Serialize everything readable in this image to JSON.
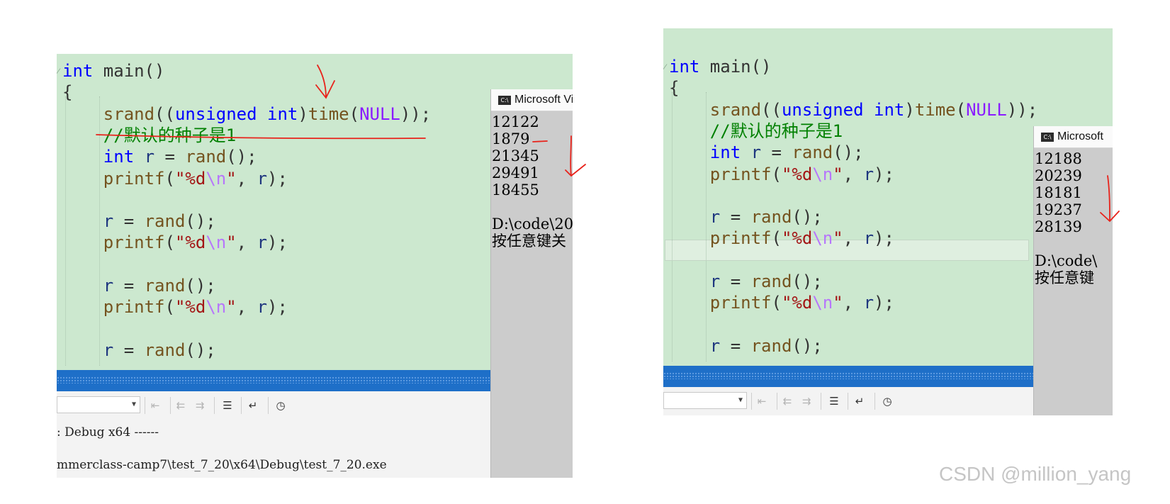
{
  "screenshots": [
    {
      "id": "left",
      "code_lines": [
        {
          "tokens": [
            {
              "t": "int",
              "c": "kw"
            },
            {
              "t": " main()",
              "c": "plain"
            }
          ]
        },
        {
          "tokens": [
            {
              "t": "{",
              "c": "plain"
            }
          ]
        },
        {
          "tokens": [
            {
              "t": "    ",
              "c": "plain"
            },
            {
              "t": "srand",
              "c": "fn"
            },
            {
              "t": "((",
              "c": "plain"
            },
            {
              "t": "unsigned",
              "c": "kw"
            },
            {
              "t": " ",
              "c": "plain"
            },
            {
              "t": "int",
              "c": "kw"
            },
            {
              "t": ")",
              "c": "plain"
            },
            {
              "t": "time",
              "c": "fn"
            },
            {
              "t": "(",
              "c": "plain"
            },
            {
              "t": "NULL",
              "c": "mac"
            },
            {
              "t": "));",
              "c": "plain"
            }
          ]
        },
        {
          "tokens": [
            {
              "t": "    ",
              "c": "plain"
            },
            {
              "t": "//默认的种子是1",
              "c": "cmt"
            }
          ]
        },
        {
          "tokens": [
            {
              "t": "    ",
              "c": "plain"
            },
            {
              "t": "int",
              "c": "kw"
            },
            {
              "t": " ",
              "c": "plain"
            },
            {
              "t": "r",
              "c": "var"
            },
            {
              "t": " = ",
              "c": "plain"
            },
            {
              "t": "rand",
              "c": "fn"
            },
            {
              "t": "();",
              "c": "plain"
            }
          ]
        },
        {
          "tokens": [
            {
              "t": "    ",
              "c": "plain"
            },
            {
              "t": "printf",
              "c": "fn"
            },
            {
              "t": "(",
              "c": "plain"
            },
            {
              "t": "\"%d",
              "c": "str"
            },
            {
              "t": "\\n",
              "c": "esc"
            },
            {
              "t": "\"",
              "c": "str"
            },
            {
              "t": ", ",
              "c": "plain"
            },
            {
              "t": "r",
              "c": "var"
            },
            {
              "t": ");",
              "c": "plain"
            }
          ]
        },
        {
          "tokens": []
        },
        {
          "tokens": [
            {
              "t": "    ",
              "c": "plain"
            },
            {
              "t": "r",
              "c": "var"
            },
            {
              "t": " = ",
              "c": "plain"
            },
            {
              "t": "rand",
              "c": "fn"
            },
            {
              "t": "();",
              "c": "plain"
            }
          ]
        },
        {
          "tokens": [
            {
              "t": "    ",
              "c": "plain"
            },
            {
              "t": "printf",
              "c": "fn"
            },
            {
              "t": "(",
              "c": "plain"
            },
            {
              "t": "\"%d",
              "c": "str"
            },
            {
              "t": "\\n",
              "c": "esc"
            },
            {
              "t": "\"",
              "c": "str"
            },
            {
              "t": ", ",
              "c": "plain"
            },
            {
              "t": "r",
              "c": "var"
            },
            {
              "t": ");",
              "c": "plain"
            }
          ]
        },
        {
          "tokens": []
        },
        {
          "tokens": [
            {
              "t": "    ",
              "c": "plain"
            },
            {
              "t": "r",
              "c": "var"
            },
            {
              "t": " = ",
              "c": "plain"
            },
            {
              "t": "rand",
              "c": "fn"
            },
            {
              "t": "();",
              "c": "plain"
            }
          ]
        },
        {
          "tokens": [
            {
              "t": "    ",
              "c": "plain"
            },
            {
              "t": "printf",
              "c": "fn"
            },
            {
              "t": "(",
              "c": "plain"
            },
            {
              "t": "\"%d",
              "c": "str"
            },
            {
              "t": "\\n",
              "c": "esc"
            },
            {
              "t": "\"",
              "c": "str"
            },
            {
              "t": ", ",
              "c": "plain"
            },
            {
              "t": "r",
              "c": "var"
            },
            {
              "t": ");",
              "c": "plain"
            }
          ]
        },
        {
          "tokens": []
        },
        {
          "tokens": [
            {
              "t": "    ",
              "c": "plain"
            },
            {
              "t": "r",
              "c": "var"
            },
            {
              "t": " = ",
              "c": "plain"
            },
            {
              "t": "rand",
              "c": "fn"
            },
            {
              "t": "();",
              "c": "plain"
            }
          ]
        }
      ],
      "console": {
        "title": "Microsoft Vi",
        "lines": [
          "12122",
          "1879",
          "21345",
          "29491",
          "18455",
          "",
          "D:\\code\\20",
          "按任意键关"
        ]
      },
      "output_lines": [
        ": Debug x64 ------",
        "mmerclass-camp7\\test_7_20\\x64\\Debug\\test_7_20.exe"
      ]
    },
    {
      "id": "right",
      "code_lines": [
        {
          "tokens": [
            {
              "t": "int",
              "c": "kw"
            },
            {
              "t": " main()",
              "c": "plain"
            }
          ]
        },
        {
          "tokens": [
            {
              "t": "{",
              "c": "plain"
            }
          ]
        },
        {
          "tokens": [
            {
              "t": "    ",
              "c": "plain"
            },
            {
              "t": "srand",
              "c": "fn"
            },
            {
              "t": "((",
              "c": "plain"
            },
            {
              "t": "unsigned",
              "c": "kw"
            },
            {
              "t": " ",
              "c": "plain"
            },
            {
              "t": "int",
              "c": "kw"
            },
            {
              "t": ")",
              "c": "plain"
            },
            {
              "t": "time",
              "c": "fn"
            },
            {
              "t": "(",
              "c": "plain"
            },
            {
              "t": "NULL",
              "c": "mac"
            },
            {
              "t": "));",
              "c": "plain"
            }
          ]
        },
        {
          "tokens": [
            {
              "t": "    ",
              "c": "plain"
            },
            {
              "t": "//默认的种子是1",
              "c": "cmt"
            }
          ]
        },
        {
          "tokens": [
            {
              "t": "    ",
              "c": "plain"
            },
            {
              "t": "int",
              "c": "kw"
            },
            {
              "t": " ",
              "c": "plain"
            },
            {
              "t": "r",
              "c": "var"
            },
            {
              "t": " = ",
              "c": "plain"
            },
            {
              "t": "rand",
              "c": "fn"
            },
            {
              "t": "();",
              "c": "plain"
            }
          ]
        },
        {
          "tokens": [
            {
              "t": "    ",
              "c": "plain"
            },
            {
              "t": "printf",
              "c": "fn"
            },
            {
              "t": "(",
              "c": "plain"
            },
            {
              "t": "\"%d",
              "c": "str"
            },
            {
              "t": "\\n",
              "c": "esc"
            },
            {
              "t": "\"",
              "c": "str"
            },
            {
              "t": ", ",
              "c": "plain"
            },
            {
              "t": "r",
              "c": "var"
            },
            {
              "t": ");",
              "c": "plain"
            }
          ]
        },
        {
          "tokens": []
        },
        {
          "tokens": [
            {
              "t": "    ",
              "c": "plain"
            },
            {
              "t": "r",
              "c": "var"
            },
            {
              "t": " = ",
              "c": "plain"
            },
            {
              "t": "rand",
              "c": "fn"
            },
            {
              "t": "();",
              "c": "plain"
            }
          ]
        },
        {
          "tokens": [
            {
              "t": "    ",
              "c": "plain"
            },
            {
              "t": "printf",
              "c": "fn"
            },
            {
              "t": "(",
              "c": "plain"
            },
            {
              "t": "\"%d",
              "c": "str"
            },
            {
              "t": "\\n",
              "c": "esc"
            },
            {
              "t": "\"",
              "c": "str"
            },
            {
              "t": ", ",
              "c": "plain"
            },
            {
              "t": "r",
              "c": "var"
            },
            {
              "t": ");",
              "c": "plain"
            }
          ]
        },
        {
          "tokens": []
        },
        {
          "tokens": [
            {
              "t": "    ",
              "c": "plain"
            },
            {
              "t": "r",
              "c": "var"
            },
            {
              "t": " = ",
              "c": "plain"
            },
            {
              "t": "rand",
              "c": "fn"
            },
            {
              "t": "();",
              "c": "plain"
            }
          ]
        },
        {
          "tokens": [
            {
              "t": "    ",
              "c": "plain"
            },
            {
              "t": "printf",
              "c": "fn"
            },
            {
              "t": "(",
              "c": "plain"
            },
            {
              "t": "\"%d",
              "c": "str"
            },
            {
              "t": "\\n",
              "c": "esc"
            },
            {
              "t": "\"",
              "c": "str"
            },
            {
              "t": ", ",
              "c": "plain"
            },
            {
              "t": "r",
              "c": "var"
            },
            {
              "t": ");",
              "c": "plain"
            }
          ]
        },
        {
          "tokens": []
        },
        {
          "tokens": [
            {
              "t": "    ",
              "c": "plain"
            },
            {
              "t": "r",
              "c": "var"
            },
            {
              "t": " = ",
              "c": "plain"
            },
            {
              "t": "rand",
              "c": "fn"
            },
            {
              "t": "();",
              "c": "plain"
            }
          ]
        }
      ],
      "console": {
        "title": "Microsoft",
        "lines": [
          "12188",
          "20239",
          "18181",
          "19237",
          "28139",
          "",
          "D:\\code\\",
          "按任意键"
        ]
      }
    }
  ],
  "toolbar_icons": [
    "find-previous-icon",
    "indent-left-icon",
    "indent-right-icon",
    "clear-all-icon",
    "word-wrap-icon",
    "clock-icon"
  ],
  "console_icon_label": "C:\\",
  "watermark": "CSDN @million_yang",
  "colors": {
    "editor_bg": "#cce8cf",
    "keyword": "#0000ff",
    "function": "#74531f",
    "variable": "#1f377f",
    "string": "#a31515",
    "escape": "#b776fb",
    "macro": "#8a1bff",
    "comment": "#008000",
    "status_bar": "#1e6fc8",
    "console_bg": "#cccccc",
    "annotation": "#e8231b"
  }
}
